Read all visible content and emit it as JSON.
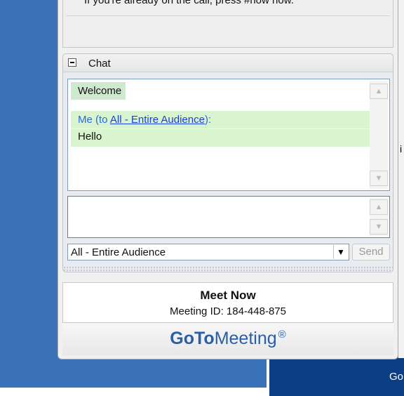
{
  "top": {
    "instruction_text": "If you're already on the call, press #now now."
  },
  "chat": {
    "title": "Chat",
    "welcome": "Welcome",
    "message": {
      "sender": "Me",
      "prefix": " (to ",
      "recipient_link": "All - Entire Audience",
      "suffix": "):",
      "text": "Hello"
    },
    "recipient_select_value": "All - Entire Audience",
    "send_label": "Send"
  },
  "meeting": {
    "status": "Meet Now",
    "meeting_id": "Meeting ID: 184-448-875"
  },
  "brand": {
    "bold_part": "GoTo",
    "regular_part": "Meeting",
    "mark": "®",
    "color": "#2a5fa8"
  },
  "background": {
    "partial_text": "Go",
    "partial_mark": "i"
  }
}
